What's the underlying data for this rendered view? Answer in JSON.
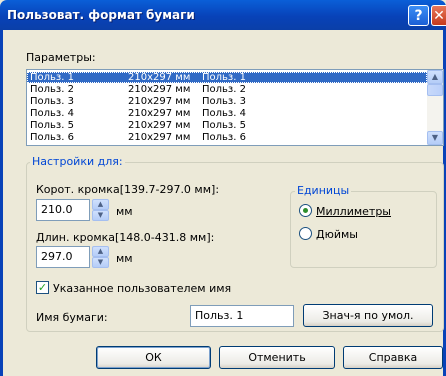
{
  "window": {
    "title": "Пользоват. формат бумаги",
    "help_symbol": "?",
    "close_symbol": "✕"
  },
  "params": {
    "label": "Параметры:",
    "rows": [
      {
        "name": "Польз. 1",
        "size": "210x297 мм",
        "desc": "Польз. 1"
      },
      {
        "name": "Польз. 2",
        "size": "210x297 мм",
        "desc": "Польз. 2"
      },
      {
        "name": "Польз. 3",
        "size": "210x297 мм",
        "desc": "Польз. 3"
      },
      {
        "name": "Польз. 4",
        "size": "210x297 мм",
        "desc": "Польз. 4"
      },
      {
        "name": "Польз. 5",
        "size": "210x297 мм",
        "desc": "Польз. 5"
      },
      {
        "name": "Польз. 6",
        "size": "210x297 мм",
        "desc": "Польз. 6"
      }
    ],
    "selected_index": 0
  },
  "settings": {
    "title": "Настройки для:",
    "short_label": "Корот. кромка[139.7-297.0 мм]:",
    "short_value": "210.0",
    "long_label": "Длин. кромка[148.0-431.8 мм]:",
    "long_value": "297.0",
    "unit": "мм"
  },
  "units": {
    "title": "Единицы",
    "mm_label": "Миллиметры",
    "in_label": "Дюймы",
    "selected": "mm"
  },
  "custom_name": {
    "checkbox_label": "Указанное пользователем имя",
    "checked": true,
    "field_label": "Имя бумаги:",
    "value": "Польз. 1",
    "default_button": "Знач-я по умол."
  },
  "footer": {
    "ok": "ОК",
    "cancel": "Отменить",
    "help": "Справка"
  }
}
